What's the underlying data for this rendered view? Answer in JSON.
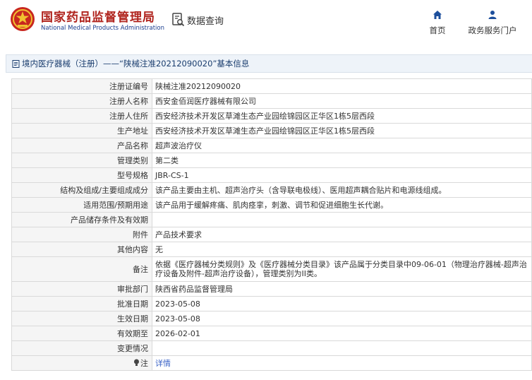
{
  "header": {
    "brand_cn": "国家药品监督管理局",
    "brand_en": "National Medical Products Administration",
    "query_label": "数据查询",
    "nav": [
      {
        "label": "首页",
        "icon": "home-icon"
      },
      {
        "label": "政务服务门户",
        "icon": "user-icon"
      }
    ]
  },
  "breadcrumb": {
    "text": "境内医疗器械（注册）——“陕械注准20212090020”基本信息"
  },
  "colors": {
    "brand_red": "#b0241e",
    "brand_blue": "#1a3d8f",
    "link_blue": "#3a63c7"
  },
  "rows": [
    {
      "label": "注册证编号",
      "value": "陕械注准20212090020"
    },
    {
      "label": "注册人名称",
      "value": "西安金佰润医疗器械有限公司"
    },
    {
      "label": "注册人住所",
      "value": "西安经济技术开发区草滩生态产业园绘锦园区正华区1栋5层西段"
    },
    {
      "label": "生产地址",
      "value": "西安经济技术开发区草滩生态产业园绘锦园区正华区1栋5层西段"
    },
    {
      "label": "产品名称",
      "value": "超声波治疗仪"
    },
    {
      "label": "管理类别",
      "value": "第二类"
    },
    {
      "label": "型号规格",
      "value": "JBR-CS-1"
    },
    {
      "label": "结构及组成/主要组成成分",
      "value": "该产品主要由主机、超声治疗头（含导联电极线）、医用超声耦合贴片和电源线组成。"
    },
    {
      "label": "适用范围/预期用途",
      "value": "该产品用于缓解疼痛、肌肉痉挛，刺激、调节和促进细胞生长代谢。"
    },
    {
      "label": "产品储存条件及有效期",
      "value": ""
    },
    {
      "label": "附件",
      "value": "产品技术要求"
    },
    {
      "label": "其他内容",
      "value": "无"
    },
    {
      "label": "备注",
      "value": "依据《医疗器械分类规则》及《医疗器械分类目录》该产品属于分类目录中09-06-01（物理治疗器械-超声治疗设备及附件-超声治疗设备），管理类别为II类。"
    },
    {
      "label": "审批部门",
      "value": "陕西省药品监督管理局"
    },
    {
      "label": "批准日期",
      "value": "2023-05-08"
    },
    {
      "label": "生效日期",
      "value": "2023-05-08"
    },
    {
      "label": "有效期至",
      "value": "2026-02-01"
    },
    {
      "label": "变更情况",
      "value": ""
    }
  ],
  "note_row": {
    "label": "注",
    "value": "详情",
    "icon": "bulb-icon"
  }
}
